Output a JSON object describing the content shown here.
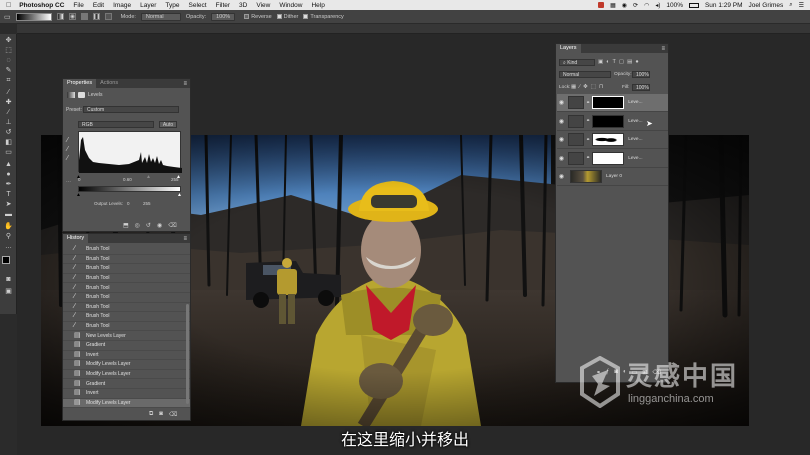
{
  "menubar": {
    "app": "Photoshop CC",
    "items": [
      "File",
      "Edit",
      "Image",
      "Layer",
      "Type",
      "Select",
      "Filter",
      "3D",
      "View",
      "Window",
      "Help"
    ],
    "battery": "100%",
    "clock": "Sun 1:29 PM",
    "user": "Joel Grimes"
  },
  "options": {
    "mode_label": "Mode:",
    "mode_value": "Normal",
    "opacity_label": "Opacity:",
    "opacity_value": "100%",
    "reverse": "Reverse",
    "dither": "Dither",
    "transparency": "Transparency"
  },
  "properties": {
    "tabs": [
      "Properties",
      "Actions"
    ],
    "title": "Levels",
    "preset_label": "Preset:",
    "preset_value": "Custom",
    "channel": "RGB",
    "auto_label": "Auto",
    "input_values": [
      "0",
      "0.60",
      "255"
    ],
    "output_label": "Output Levels:",
    "output_values": [
      "0",
      "255"
    ]
  },
  "history": {
    "title": "History",
    "items": [
      {
        "label": "Brush Tool",
        "icon": "brush-icon"
      },
      {
        "label": "Brush Tool",
        "icon": "brush-icon"
      },
      {
        "label": "Brush Tool",
        "icon": "brush-icon"
      },
      {
        "label": "Brush Tool",
        "icon": "brush-icon"
      },
      {
        "label": "Brush Tool",
        "icon": "brush-icon"
      },
      {
        "label": "Brush Tool",
        "icon": "brush-icon"
      },
      {
        "label": "Brush Tool",
        "icon": "brush-icon"
      },
      {
        "label": "Brush Tool",
        "icon": "brush-icon"
      },
      {
        "label": "Brush Tool",
        "icon": "brush-icon"
      },
      {
        "label": "New Levels Layer",
        "icon": "document-icon"
      },
      {
        "label": "Gradient",
        "icon": "document-icon"
      },
      {
        "label": "Invert",
        "icon": "document-icon"
      },
      {
        "label": "Modify Levels Layer",
        "icon": "document-icon"
      },
      {
        "label": "Modify Levels Layer",
        "icon": "document-icon"
      },
      {
        "label": "Gradient",
        "icon": "document-icon"
      },
      {
        "label": "Invert",
        "icon": "document-icon"
      },
      {
        "label": "Modify Levels Layer",
        "icon": "document-icon"
      }
    ]
  },
  "layers": {
    "title": "Layers",
    "kind_label": "Kind",
    "blend_mode": "Normal",
    "opacity_label": "Opacity:",
    "opacity_value": "100%",
    "lock_label": "Lock:",
    "fill_label": "Fill:",
    "fill_value": "100%",
    "rows": [
      {
        "name": "Leve...",
        "mask": "black"
      },
      {
        "name": "Leve...",
        "mask": "black"
      },
      {
        "name": "Leve...",
        "mask": "smudge"
      },
      {
        "name": "Leve...",
        "mask": "white"
      },
      {
        "name": "Layer 0",
        "mask": "none"
      }
    ]
  },
  "subtitle": "在这里缩小并移出",
  "watermark": {
    "cn": "灵感中国",
    "en": "lingganchina.com"
  }
}
